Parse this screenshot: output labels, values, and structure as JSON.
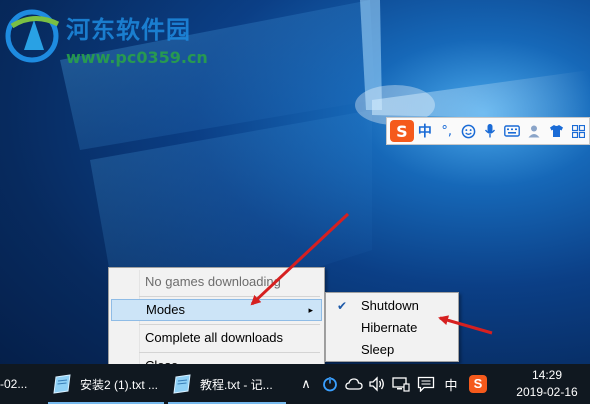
{
  "watermark": {
    "name": "河东软件园",
    "url": "www.pc0359.cn"
  },
  "ime_toolbar": {
    "logo": "S",
    "items": [
      {
        "icon": "chinese-mode",
        "glyph": "中"
      },
      {
        "icon": "punctuation",
        "glyph": "°,"
      },
      {
        "icon": "emoji",
        "glyph": "☺"
      },
      {
        "icon": "microphone",
        "glyph": "🎤"
      },
      {
        "icon": "keyboard",
        "glyph": "⌨"
      },
      {
        "icon": "user",
        "glyph": "👤"
      },
      {
        "icon": "shirt",
        "glyph": "👕"
      },
      {
        "icon": "grid",
        "glyph": "▦"
      }
    ]
  },
  "context_menu": {
    "items": [
      {
        "label": "No games downloading",
        "disabled": true
      },
      {
        "label": "Modes",
        "has_submenu": true,
        "highlighted": true
      },
      {
        "label": "Complete all downloads"
      },
      {
        "label": "Close"
      }
    ],
    "submenu_arrow": "▸"
  },
  "modes_submenu": {
    "items": [
      {
        "label": "Shutdown",
        "checked": true
      },
      {
        "label": "Hibernate",
        "checked": false
      },
      {
        "label": "Sleep",
        "checked": false
      }
    ],
    "check_glyph": "✔"
  },
  "taskbar": {
    "apps": [
      {
        "label": "-02...",
        "icon": "none"
      },
      {
        "label": "安装2 (1).txt ...",
        "icon": "notepad-icon"
      },
      {
        "label": "教程.txt - 记...",
        "icon": "notepad-icon"
      }
    ],
    "tray": {
      "chevron": "∧",
      "ime_mode": "中",
      "sogou": "S"
    },
    "clock": {
      "time": "14:29",
      "date": "2019-02-16"
    }
  },
  "colors": {
    "accent_red": "#d62020",
    "menu_highlight": "#cce4f7",
    "taskbar": "#101820"
  }
}
